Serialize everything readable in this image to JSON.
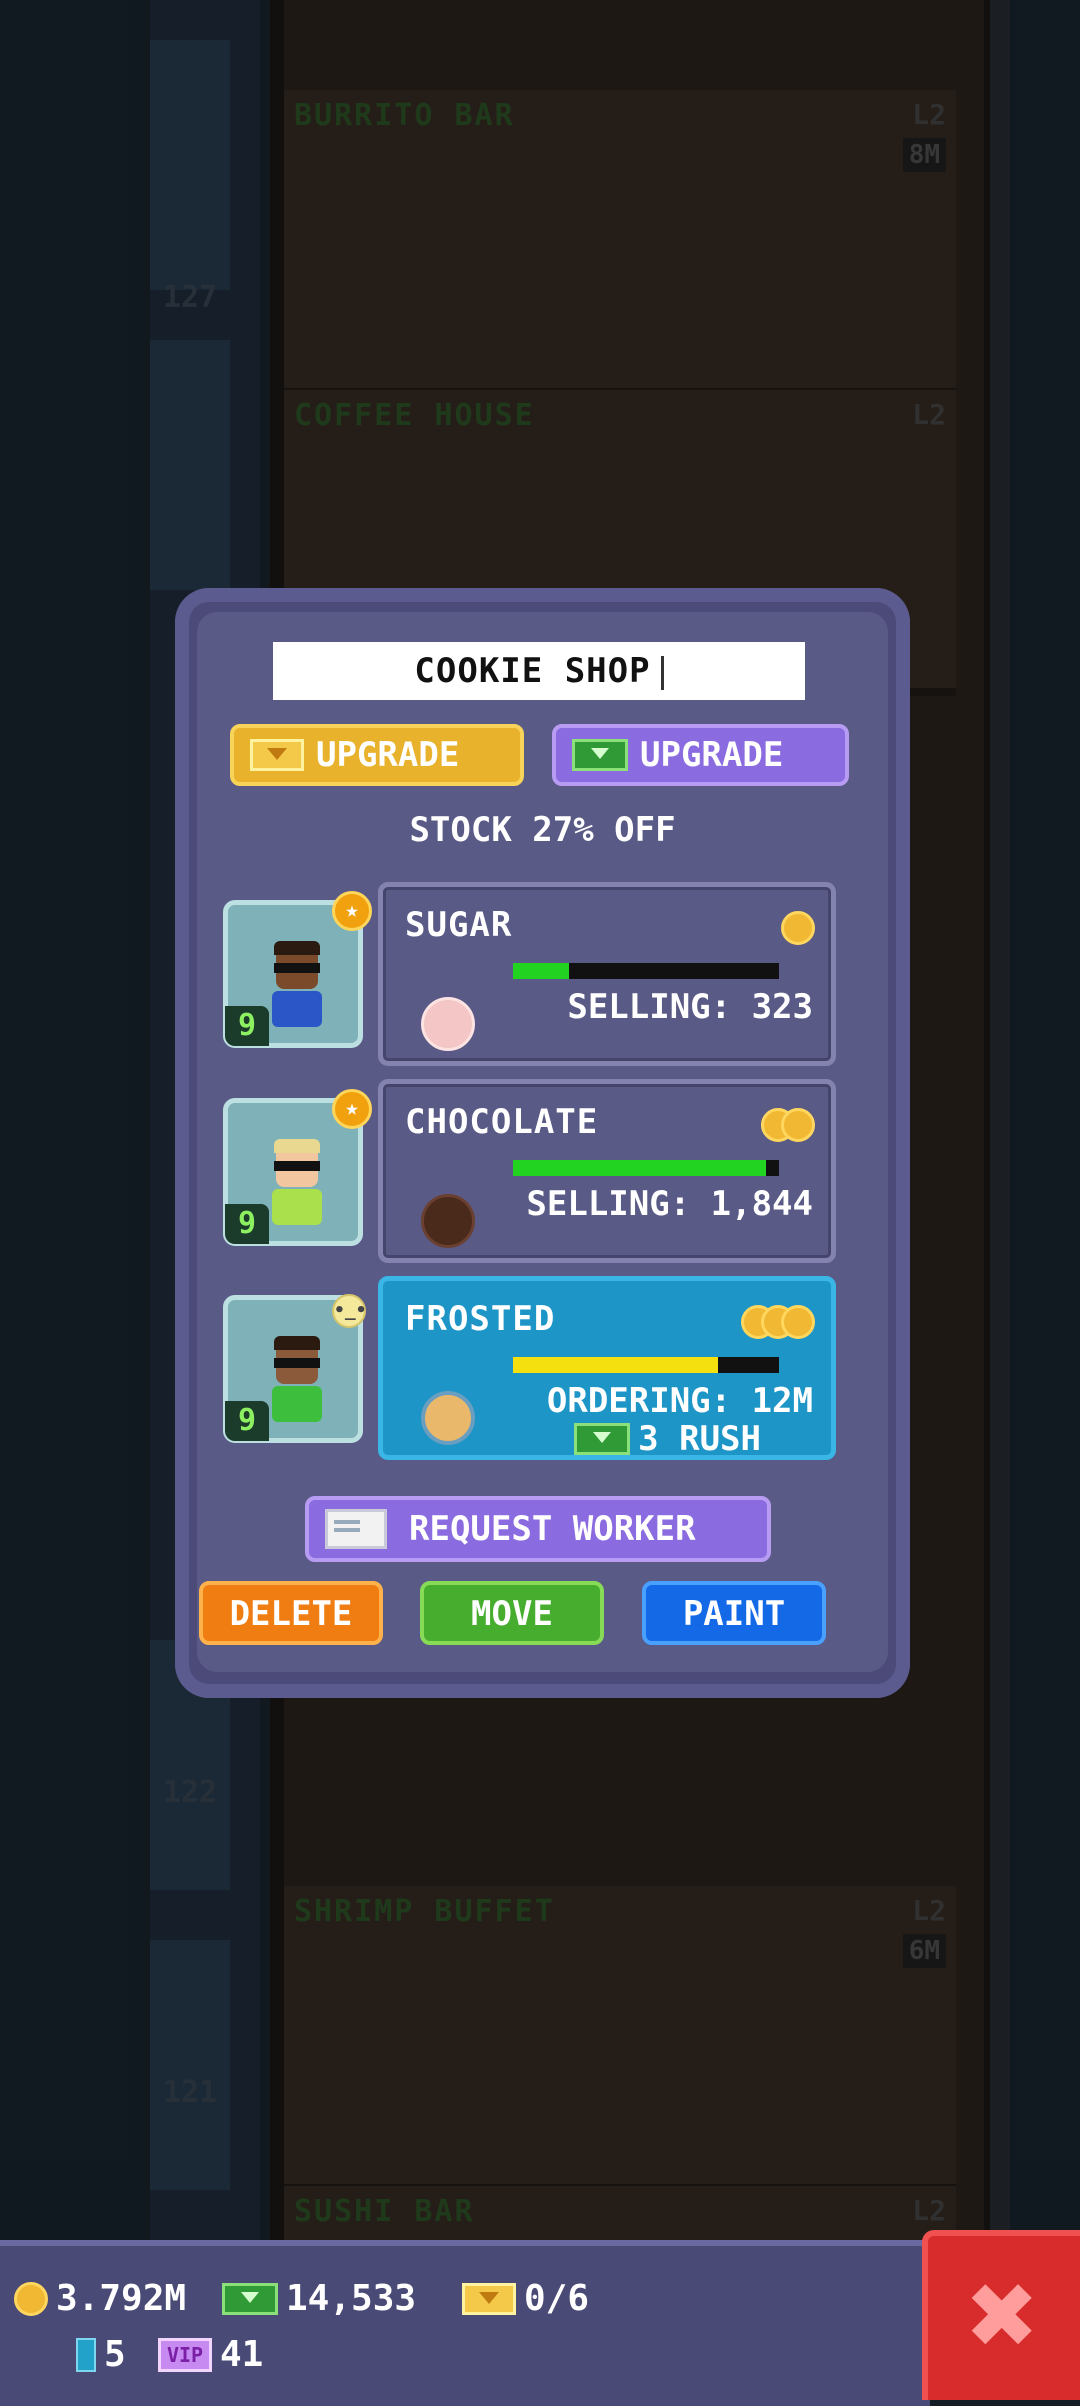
{
  "background": {
    "floors": [
      {
        "name": "BURRITO BAR",
        "level": "L2",
        "cost": "8M"
      },
      {
        "name": "COFFEE HOUSE",
        "level": "L2",
        "cost": ""
      },
      {
        "name": "SHRIMP BUFFET",
        "level": "L2",
        "cost": "6M"
      },
      {
        "name": "SUSHI BAR",
        "level": "L2",
        "cost": ""
      }
    ],
    "floor_numbers": [
      "127",
      "122",
      "121"
    ]
  },
  "dialog": {
    "store_name": "COOKIE SHOP",
    "upgrade_coins_label": "UPGRADE",
    "upgrade_bux_label": "UPGRADE",
    "stock_discount": "STOCK 27% OFF",
    "workers": [
      {
        "level": "9",
        "badge": "star"
      },
      {
        "level": "9",
        "badge": "star"
      },
      {
        "level": "9",
        "badge": "neutral-face"
      }
    ],
    "products": [
      {
        "name": "SUGAR",
        "status": "SELLING: 323",
        "progress": 0.21,
        "bar_color": "#22d322",
        "tier": 1
      },
      {
        "name": "CHOCOLATE",
        "status": "SELLING: 1,844",
        "progress": 0.95,
        "bar_color": "#22d322",
        "tier": 2
      },
      {
        "name": "FROSTED",
        "status": "ORDERING: 12M",
        "progress": 0.77,
        "bar_color": "#f4e00e",
        "tier": 3,
        "rush_label": "3 RUSH"
      }
    ],
    "request_worker_label": "REQUEST WORKER",
    "delete_label": "DELETE",
    "move_label": "MOVE",
    "paint_label": "PAINT"
  },
  "hud": {
    "coins": "3.792M",
    "bux": "14,533",
    "vip_tickets": "0/6",
    "gems": "5",
    "vip_count": "41"
  }
}
